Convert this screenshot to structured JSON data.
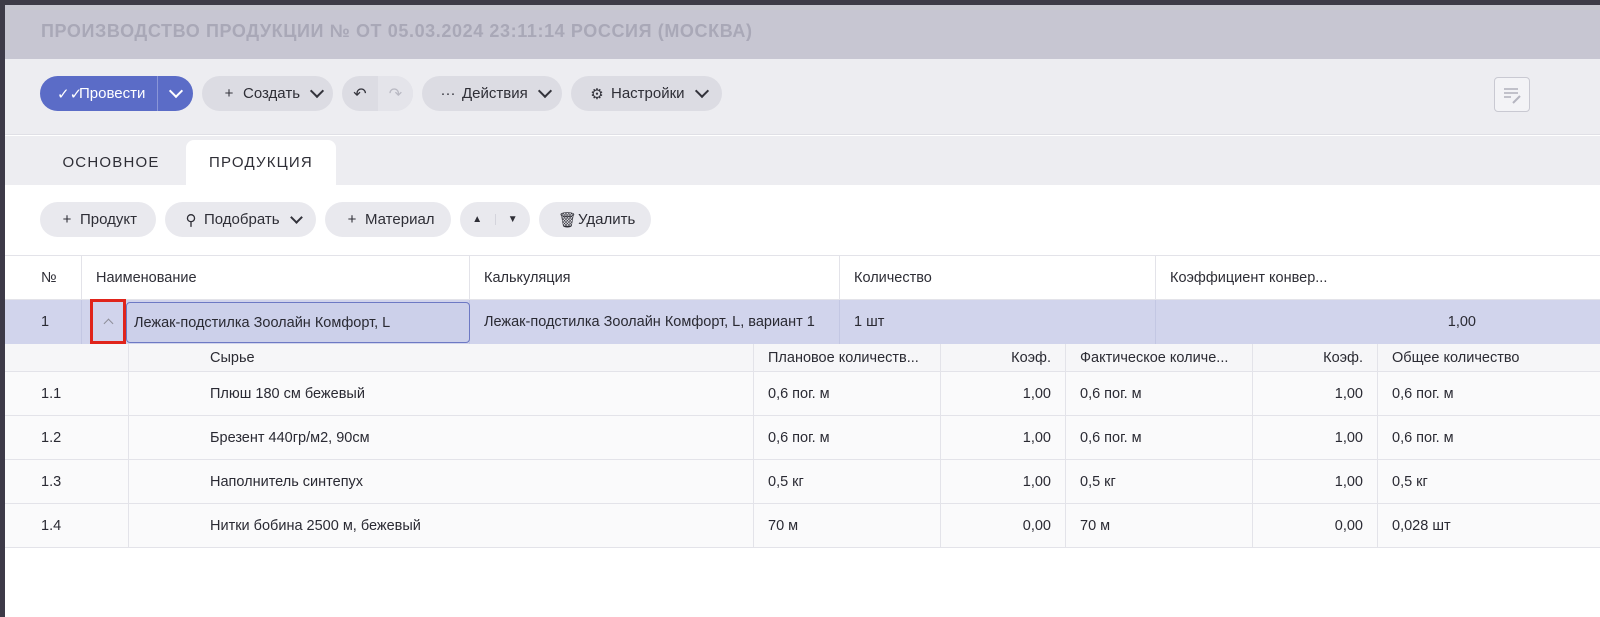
{
  "title": "ПРОИЗВОДСТВО ПРОДУКЦИИ № ОТ 05.03.2024 23:11:14 РОССИЯ (МОСКВА)",
  "toolbar": {
    "post_label": "Провести",
    "create_label": "Создать",
    "actions_label": "Действия",
    "settings_label": "Настройки"
  },
  "tabs": [
    {
      "label": "ОСНОВНОЕ",
      "active": false
    },
    {
      "label": "ПРОДУКЦИЯ",
      "active": true
    }
  ],
  "subtoolbar": {
    "product_label": "Продукт",
    "pick_label": "Подобрать",
    "material_label": "Материал",
    "delete_label": "Удалить"
  },
  "table": {
    "columns": [
      "№",
      "Наименование",
      "Калькуляция",
      "Количество",
      "Коэффициент конвер..."
    ],
    "main_row": {
      "num": "1",
      "name": "Лежак-подстилка Зоолайн Комфорт, L",
      "calc": "Лежак-подстилка Зоолайн Комфорт, L, вариант 1",
      "qty": "1 шт",
      "coef": "1,00"
    },
    "sub_columns": [
      "Сырье",
      "Плановое количеств...",
      "Коэф.",
      "Фактическое количе...",
      "Коэф.",
      "Общее количество"
    ],
    "sub_rows": [
      {
        "num": "1.1",
        "material": "Плюш 180 см бежевый",
        "plan": "0,6 пог. м",
        "coef1": "1,00",
        "fact": "0,6 пог. м",
        "coef2": "1,00",
        "total": "0,6 пог. м"
      },
      {
        "num": "1.2",
        "material": "Брезент 440гр/м2, 90см",
        "plan": "0,6 пог. м",
        "coef1": "1,00",
        "fact": "0,6 пог. м",
        "coef2": "1,00",
        "total": "0,6 пог. м"
      },
      {
        "num": "1.3",
        "material": "Наполнитель синтепух",
        "plan": "0,5 кг",
        "coef1": "1,00",
        "fact": "0,5 кг",
        "coef2": "1,00",
        "total": "0,5 кг"
      },
      {
        "num": "1.4",
        "material": "Нитки бобина 2500 м, бежевый",
        "plan": "70 м",
        "coef1": "0,00",
        "fact": "70 м",
        "coef2": "0,00",
        "total": "0,028 шт"
      }
    ]
  },
  "colors": {
    "accent": "#5b6cc7",
    "selected_row": "#d1d4ec",
    "highlight": "#e0241b"
  }
}
